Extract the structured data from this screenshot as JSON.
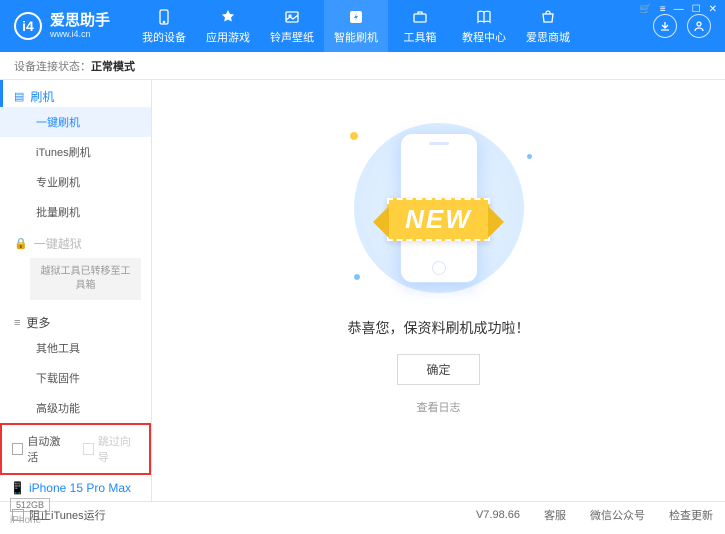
{
  "app": {
    "title": "爱思助手",
    "subtitle": "www.i4.cn"
  },
  "nav": {
    "items": [
      {
        "label": "我的设备"
      },
      {
        "label": "应用游戏"
      },
      {
        "label": "铃声壁纸"
      },
      {
        "label": "智能刷机"
      },
      {
        "label": "工具箱"
      },
      {
        "label": "教程中心"
      },
      {
        "label": "爱思商城"
      }
    ]
  },
  "status": {
    "label": "设备连接状态：",
    "mode": "正常模式"
  },
  "sidebar": {
    "flash_section": "刷机",
    "items": {
      "one_key": "一键刷机",
      "itunes": "iTunes刷机",
      "pro": "专业刷机",
      "batch": "批量刷机"
    },
    "jailbreak_section": "一键越狱",
    "jailbreak_note": "越狱工具已转移至工具箱",
    "more_section": "更多",
    "more": {
      "other_tools": "其他工具",
      "download_fw": "下载固件",
      "advanced": "高级功能"
    },
    "auto_activate": "自动激活",
    "skip_guide": "跳过向导"
  },
  "device": {
    "name": "iPhone 15 Pro Max",
    "storage": "512GB",
    "type": "iPhone"
  },
  "main": {
    "ribbon": "NEW",
    "success": "恭喜您，保资料刷机成功啦！",
    "ok": "确定",
    "view_log": "查看日志"
  },
  "footer": {
    "block_itunes": "阻止iTunes运行",
    "version": "V7.98.66",
    "support": "客服",
    "wechat": "微信公众号",
    "check_update": "检查更新"
  }
}
